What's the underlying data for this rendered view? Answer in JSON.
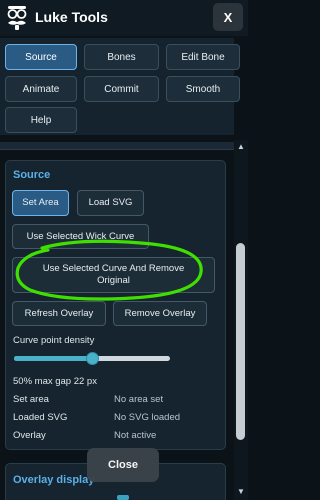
{
  "header": {
    "app_title": "Luke Tools",
    "close_label": "X"
  },
  "tabs": [
    "Source",
    "Bones",
    "Edit Bone",
    "Animate",
    "Commit",
    "Smooth",
    "Help"
  ],
  "active_tab": "Source",
  "source": {
    "title": "Source",
    "set_area_label": "Set Area",
    "load_svg_label": "Load SVG",
    "use_wick_curve_label": "Use Selected Wick Curve",
    "use_curve_remove_label": "Use Selected Curve And Remove Original",
    "refresh_overlay_label": "Refresh Overlay",
    "remove_overlay_label": "Remove Overlay",
    "density_label": "Curve point density",
    "density_value": 0.5,
    "density_readout": "50% max gap 22 px",
    "status": [
      {
        "label": "Set area",
        "value": "No area set"
      },
      {
        "label": "Loaded SVG",
        "value": "No SVG loaded"
      },
      {
        "label": "Overlay",
        "value": "Not active"
      }
    ]
  },
  "overlay_display": {
    "title": "Overlay display"
  },
  "footer": {
    "close_label": "Close"
  },
  "colors": {
    "accent": "#5cb0ea",
    "active_button": "#2a5b85",
    "slider": "#49b1c9",
    "highlight_annotation": "#3fe000"
  }
}
